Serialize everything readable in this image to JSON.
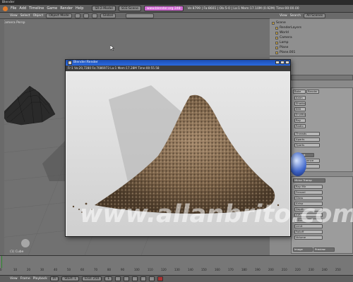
{
  "window_title": "Blender",
  "menu": [
    "File",
    "Add",
    "Timeline",
    "Game",
    "Render",
    "Help"
  ],
  "header": {
    "screen_field": "SR:2-Model",
    "scene_field": "SCE:Scene",
    "url_label": "www.blender.org 248",
    "stats": "Ve:8799 | Fa:8601 | Ob:5-0 | La:1    Mem:17.10M (0.92M)    Time:00:00.00"
  },
  "viewport": {
    "menus": [
      "View",
      "Select",
      "Object"
    ],
    "mode": "Object Mode",
    "orient": "Global",
    "corner_label": "Camera Persp",
    "frame_label": "(1) Cube"
  },
  "outliner": {
    "menus": [
      "View",
      "Search"
    ],
    "display": "All Scenes",
    "items": [
      "Scene",
      "RenderLayers",
      "World",
      "Camera",
      "Lamp",
      "Plane",
      "Plane.001"
    ]
  },
  "buttons": {
    "labels": [
      "Bake",
      "Render",
      "Anim",
      "Do Sequence",
      "Output",
      "Shadow",
      "SSS",
      "EnvMap",
      "Ray",
      "Radio",
      "Blur",
      "Threads",
      "Xparts",
      "Yparts",
      "Mirror Transp",
      "Ray Mir",
      "Fresnel",
      "Gloss",
      "Aniso",
      "Depth",
      "IOR",
      "Filter",
      "Limit",
      "Falloff",
      "Image",
      "Preview",
      "Volume",
      "Properties",
      "Metallic"
    ]
  },
  "render_window": {
    "title": "Blender:Render",
    "info": "Fr:1 Vo:20,7280 Fa:7086973 La:1 Mem:17.28M   Time:00:55.58",
    "controls": [
      "_",
      "□",
      "x"
    ]
  },
  "timeline": {
    "ticks": [
      "0",
      "10",
      "20",
      "30",
      "40",
      "50",
      "60",
      "70",
      "80",
      "90",
      "100",
      "110",
      "120",
      "130",
      "140",
      "150",
      "160",
      "170",
      "180",
      "190",
      "200",
      "210",
      "220",
      "230",
      "240",
      "250"
    ],
    "menus": [
      "View",
      "Frame",
      "Playback"
    ],
    "pr_label": "Pr",
    "start_label": "Start: 1",
    "end_label": "End: 250",
    "current": "1"
  },
  "watermark": "www.allanbrito.com",
  "colors": {
    "viewport_bg": "#717171",
    "render_title_bar": "#2a6ae0",
    "url_field": "#d16ad3"
  }
}
